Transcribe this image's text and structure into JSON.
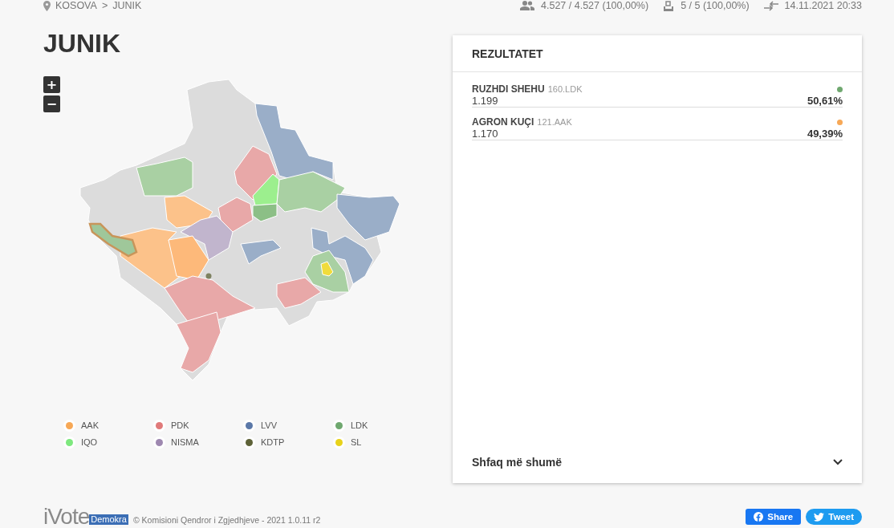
{
  "breadcrumb": {
    "items": [
      "KOSOVA",
      "JUNIK"
    ],
    "separator": ">"
  },
  "stats": [
    {
      "kind": "voters",
      "text": "4.527 / 4.527 (100,00%)"
    },
    {
      "kind": "stations",
      "text": "5 / 5 (100,00%)"
    },
    {
      "kind": "updated",
      "text": "14.11.2021 20:33"
    }
  ],
  "title": "JUNIK",
  "map_controls": {
    "zoom_in": "+",
    "zoom_out": "−"
  },
  "legend": [
    {
      "label": "AAK",
      "color": "#f7a856"
    },
    {
      "label": "PDK",
      "color": "#e07a7a"
    },
    {
      "label": "LVV",
      "color": "#5b78a8"
    },
    {
      "label": "LDK",
      "color": "#6fa86f"
    },
    {
      "label": "IQO",
      "color": "#7ee87e"
    },
    {
      "label": "NISMA",
      "color": "#9e88b0"
    },
    {
      "label": "KDTP",
      "color": "#5e6238"
    },
    {
      "label": "SL",
      "color": "#e8d21a"
    }
  ],
  "results": {
    "title": "REZULTATET",
    "candidates": [
      {
        "name": "RUZHDI SHEHU",
        "code": "160.LDK",
        "votes": "1.199",
        "percent": "50,61%",
        "color": "#6fa86f"
      },
      {
        "name": "AGRON KUÇI",
        "code": "121.AAK",
        "votes": "1.170",
        "percent": "49,39%",
        "color": "#f7a856"
      }
    ],
    "show_more": "Shfaq më shumë"
  },
  "footer": {
    "logo": "iVote",
    "logo_badge": "Demokra",
    "copyright": "© Komisioni Qendror i Zgjedhjeve - 2021 1.0.11 r2",
    "share": "Share",
    "tweet": "Tweet"
  }
}
